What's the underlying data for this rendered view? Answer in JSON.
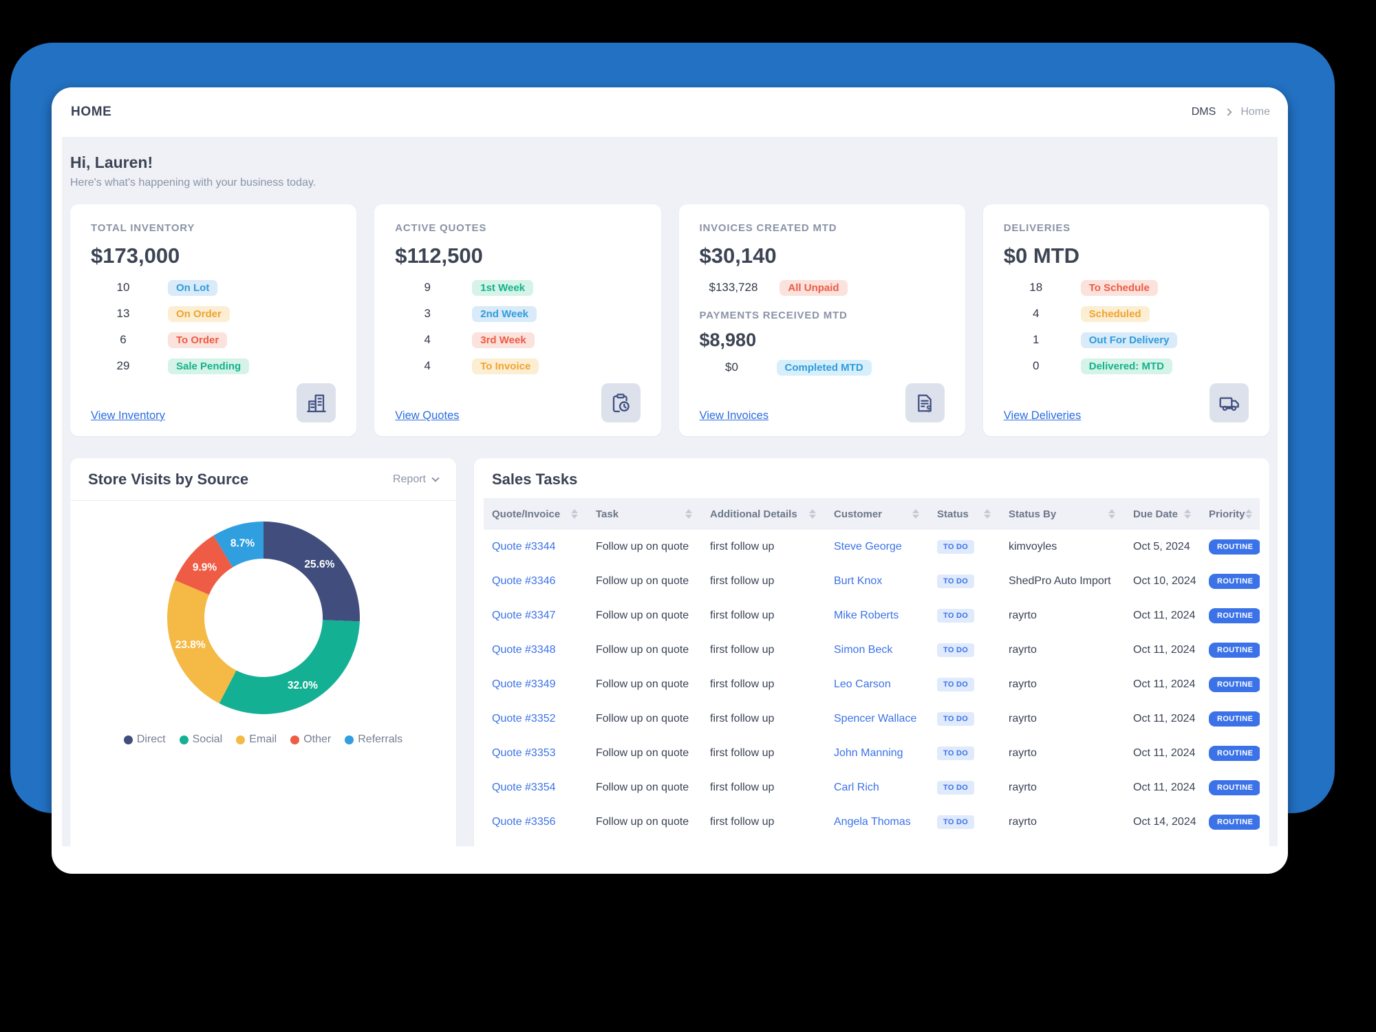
{
  "colors": {
    "frame_blue": "#2271c3",
    "content_bg": "#eff1f6",
    "accent_link": "#2b6ce2",
    "table_accent": "#3b72e8"
  },
  "app": {
    "title": "HOME",
    "breadcrumb_root": "DMS",
    "breadcrumb_current": "Home"
  },
  "greeting": {
    "title": "Hi, Lauren!",
    "subtitle": "Here's what's happening with your business today."
  },
  "stat_cards": [
    {
      "label": "TOTAL INVENTORY",
      "value": "$173,000",
      "icon": "building-icon",
      "link": "View Inventory",
      "body": [
        {
          "type": "stat",
          "count": "10",
          "badge": "On Lot",
          "color": "blue"
        },
        {
          "type": "stat",
          "count": "13",
          "badge": "On Order",
          "color": "orange"
        },
        {
          "type": "stat",
          "count": "6",
          "badge": "To Order",
          "color": "red"
        },
        {
          "type": "stat",
          "count": "29",
          "badge": "Sale Pending",
          "color": "green"
        }
      ]
    },
    {
      "label": "ACTIVE QUOTES",
      "value": "$112,500",
      "icon": "clipboard-clock-icon",
      "link": "View Quotes",
      "body": [
        {
          "type": "stat",
          "count": "9",
          "badge": "1st Week",
          "color": "green"
        },
        {
          "type": "stat",
          "count": "3",
          "badge": "2nd Week",
          "color": "blue"
        },
        {
          "type": "stat",
          "count": "4",
          "badge": "3rd Week",
          "color": "red"
        },
        {
          "type": "stat",
          "count": "4",
          "badge": "To Invoice",
          "color": "orange"
        }
      ]
    },
    {
      "label": "INVOICES CREATED MTD",
      "value": "$30,140",
      "icon": "invoice-dollar-icon",
      "link": "View Invoices",
      "body": [
        {
          "type": "stat",
          "count": "$133,728",
          "badge": "All Unpaid",
          "color": "red"
        },
        {
          "type": "sublabel",
          "text": "PAYMENTS RECEIVED MTD"
        },
        {
          "type": "subvalue",
          "text": "$8,980"
        },
        {
          "type": "stat",
          "count": "$0",
          "badge": "Completed MTD",
          "color": "lightblue"
        }
      ]
    },
    {
      "label": "DELIVERIES",
      "value": "$0 MTD",
      "icon": "truck-icon",
      "link": "View Deliveries",
      "body": [
        {
          "type": "stat",
          "count": "18",
          "badge": "To Schedule",
          "color": "red"
        },
        {
          "type": "stat",
          "count": "4",
          "badge": "Scheduled",
          "color": "orange"
        },
        {
          "type": "stat",
          "count": "1",
          "badge": "Out For Delivery",
          "color": "blue"
        },
        {
          "type": "stat",
          "count": "0",
          "badge": "Delivered: MTD",
          "color": "green"
        }
      ]
    }
  ],
  "chart_panel": {
    "title": "Store Visits by Source",
    "report_label": "Report"
  },
  "chart_data": {
    "type": "pie",
    "subtype": "donut",
    "title": "Store Visits by Source",
    "labels": [
      "Direct",
      "Social",
      "Email",
      "Other",
      "Referrals"
    ],
    "values": [
      25.6,
      32.0,
      23.8,
      9.9,
      8.7
    ],
    "unit": "percent",
    "slice_labels": [
      "25.6%",
      "32.0%",
      "23.8%",
      "9.9%",
      "8.7%"
    ],
    "colors": [
      "#414e7d",
      "#14b094",
      "#f5b945",
      "#ee5c45",
      "#2f9fe0"
    ],
    "start_angle_deg": 0,
    "direction": "clockwise",
    "legend_position": "bottom"
  },
  "tasks_panel": {
    "title": "Sales Tasks",
    "columns": [
      "Quote/Invoice",
      "Task",
      "Additional Details",
      "Customer",
      "Status",
      "Status By",
      "Due Date",
      "Priority"
    ],
    "rows": [
      {
        "quote": "Quote #3344",
        "task": "Follow up on quote",
        "details": "first follow up",
        "customer": "Steve George",
        "status": "TO DO",
        "status_by": "kimvoyles",
        "due": "Oct 5, 2024",
        "priority": "ROUTINE"
      },
      {
        "quote": "Quote #3346",
        "task": "Follow up on quote",
        "details": "first follow up",
        "customer": "Burt Knox",
        "status": "TO DO",
        "status_by": "ShedPro Auto Import",
        "due": "Oct 10, 2024",
        "priority": "ROUTINE"
      },
      {
        "quote": "Quote #3347",
        "task": "Follow up on quote",
        "details": "first follow up",
        "customer": "Mike Roberts",
        "status": "TO DO",
        "status_by": "rayrto",
        "due": "Oct 11, 2024",
        "priority": "ROUTINE"
      },
      {
        "quote": "Quote #3348",
        "task": "Follow up on quote",
        "details": "first follow up",
        "customer": "Simon Beck",
        "status": "TO DO",
        "status_by": "rayrto",
        "due": "Oct 11, 2024",
        "priority": "ROUTINE"
      },
      {
        "quote": "Quote #3349",
        "task": "Follow up on quote",
        "details": "first follow up",
        "customer": "Leo Carson",
        "status": "TO DO",
        "status_by": "rayrto",
        "due": "Oct 11, 2024",
        "priority": "ROUTINE"
      },
      {
        "quote": "Quote #3352",
        "task": "Follow up on quote",
        "details": "first follow up",
        "customer": "Spencer Wallace",
        "status": "TO DO",
        "status_by": "rayrto",
        "due": "Oct 11, 2024",
        "priority": "ROUTINE"
      },
      {
        "quote": "Quote #3353",
        "task": "Follow up on quote",
        "details": "first follow up",
        "customer": "John Manning",
        "status": "TO DO",
        "status_by": "rayrto",
        "due": "Oct 11, 2024",
        "priority": "ROUTINE"
      },
      {
        "quote": "Quote #3354",
        "task": "Follow up on quote",
        "details": "first follow up",
        "customer": "Carl Rich",
        "status": "TO DO",
        "status_by": "rayrto",
        "due": "Oct 11, 2024",
        "priority": "ROUTINE"
      },
      {
        "quote": "Quote #3356",
        "task": "Follow up on quote",
        "details": "first follow up",
        "customer": "Angela Thomas",
        "status": "TO DO",
        "status_by": "rayrto",
        "due": "Oct 14, 2024",
        "priority": "ROUTINE"
      }
    ]
  }
}
